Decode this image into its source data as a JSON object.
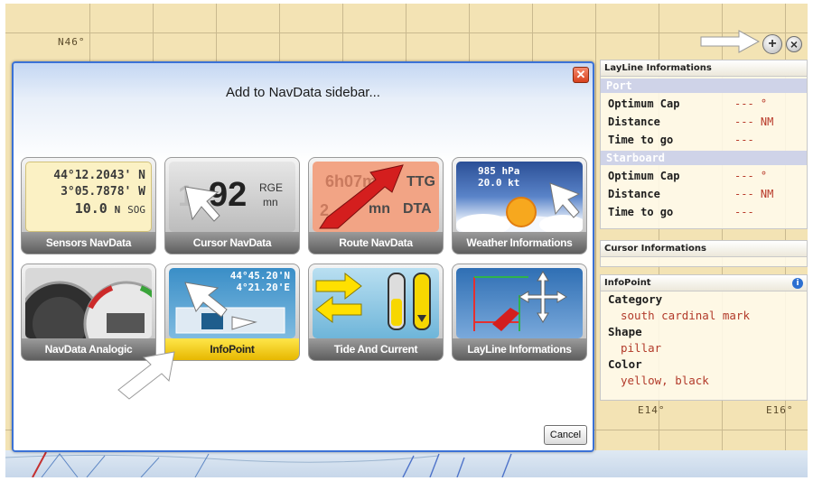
{
  "chart": {
    "lat_label": "N46°",
    "lon_label_1": "E14°",
    "lon_label_2": "E16°"
  },
  "toolbar": {
    "zoom_in_glyph": "+",
    "close_glyph": "×"
  },
  "dialog": {
    "title": "Add to NavData sidebar...",
    "close_glyph": "✕",
    "cancel_label": "Cancel",
    "tiles": [
      {
        "label": "Sensors NavData"
      },
      {
        "label": "Cursor NavData"
      },
      {
        "label": "Route NavData"
      },
      {
        "label": "Weather Informations"
      },
      {
        "label": "NavData Analogic"
      },
      {
        "label": "InfoPoint"
      },
      {
        "label": "Tide And Current"
      },
      {
        "label": "LayLine Informations"
      }
    ],
    "sensors_preview": {
      "line1": "44°12.2043' N",
      "line2": "3°05.7878' W",
      "line3_value": "10.0",
      "line3_unit": "N",
      "line3_tag": "SOG"
    },
    "cursor_preview": {
      "digits": "92",
      "faded": "1",
      "unit1": "RGE",
      "unit2": "mn"
    },
    "route_preview": {
      "top": "6h07m",
      "top_tag": "TTG",
      "bottom": "2",
      "bottom_unit": "mn",
      "bottom_tag": "DTA"
    },
    "weather_preview": {
      "pressure": "985 hPa",
      "wind": "20.0 kt"
    },
    "infopoint_preview": {
      "lat": "44°45.20'N",
      "lon": "4°21.20'E"
    }
  },
  "sidebar": {
    "layline": {
      "title": "LayLine Informations",
      "port": "Port",
      "starboard": "Starboard",
      "optimum_cap_label": "Optimum Cap",
      "optimum_cap_value": "--- °",
      "distance_label": "Distance",
      "distance_value": "--- NM",
      "time_label": "Time to go",
      "time_value": "---"
    },
    "cursor": {
      "title": "Cursor Informations"
    },
    "infopoint": {
      "title": "InfoPoint",
      "info_glyph": "i",
      "category_label": "Category",
      "category_value": "south cardinal mark",
      "shape_label": "Shape",
      "shape_value": "pillar",
      "color_label": "Color",
      "color_value": "yellow, black"
    }
  }
}
